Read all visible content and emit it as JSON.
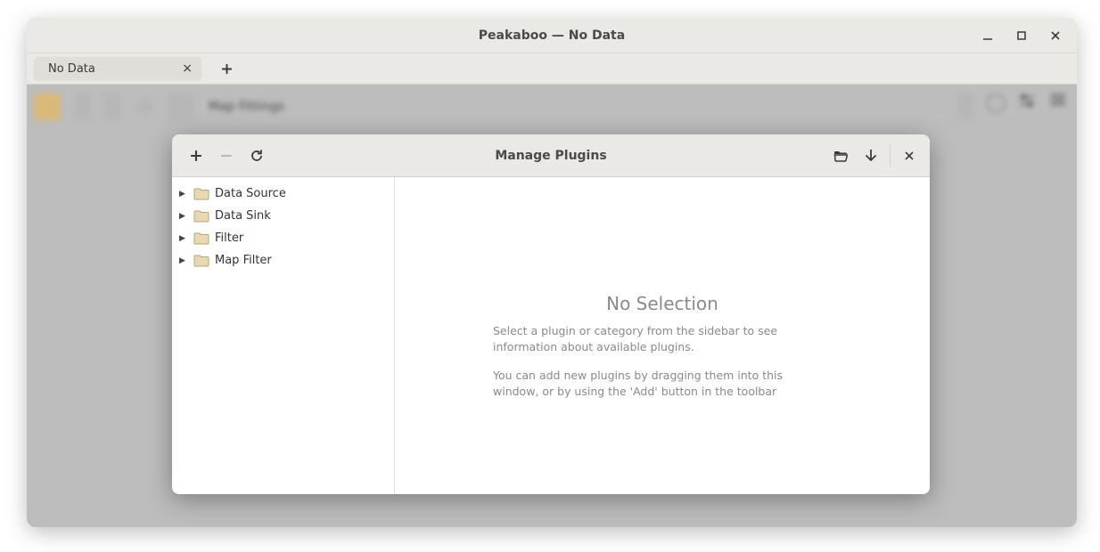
{
  "window": {
    "title": "Peakaboo — No Data"
  },
  "tabs": {
    "active_label": "No Data"
  },
  "main_toolbar": {
    "faded_label": "Map Fittings"
  },
  "dialog": {
    "title": "Manage Plugins",
    "sidebar": {
      "items": [
        {
          "label": "Data Source"
        },
        {
          "label": "Data Sink"
        },
        {
          "label": "Filter"
        },
        {
          "label": "Map Filter"
        }
      ]
    },
    "main": {
      "heading": "No Selection",
      "paragraph1": "Select a plugin or category from the sidebar to see information about available plugins.",
      "paragraph2": "You can add new plugins by dragging them into this window, or by using the 'Add' button in the toolbar"
    }
  }
}
